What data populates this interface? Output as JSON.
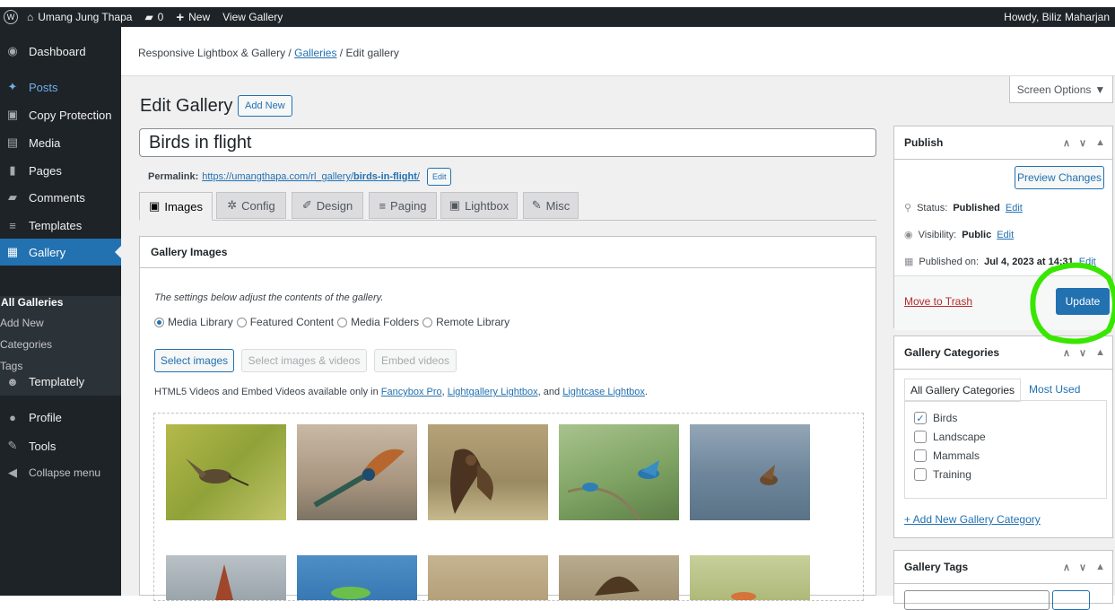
{
  "adminbar": {
    "site_name": "Umang Jung Thapa",
    "comments_count": "0",
    "new_label": "New",
    "view_gallery": "View Gallery",
    "howdy": "Howdy, Biliz Maharjan"
  },
  "sidebar": {
    "items": [
      {
        "label": "Dashboard",
        "icon": "dashboard-icon"
      },
      {
        "label": "Posts",
        "icon": "pin-icon"
      },
      {
        "label": "Copy Protection",
        "icon": "lock-icon"
      },
      {
        "label": "Media",
        "icon": "media-icon"
      },
      {
        "label": "Pages",
        "icon": "page-icon"
      },
      {
        "label": "Comments",
        "icon": "comment-icon"
      },
      {
        "label": "Templates",
        "icon": "templates-icon"
      },
      {
        "label": "Gallery",
        "icon": "gallery-icon"
      },
      {
        "label": "Templately",
        "icon": "templately-icon"
      },
      {
        "label": "Profile",
        "icon": "user-icon"
      },
      {
        "label": "Tools",
        "icon": "wrench-icon"
      },
      {
        "label": "Collapse menu",
        "icon": "collapse-icon"
      }
    ],
    "submenu": [
      "All Galleries",
      "Add New",
      "Categories",
      "Tags"
    ]
  },
  "breadcrumb": {
    "part1": "Responsive Lightbox & Gallery",
    "sep": " / ",
    "part2": "Galleries",
    "part3": "Edit gallery"
  },
  "screen_options": "Screen Options",
  "page": {
    "title": "Edit Gallery",
    "add_new": "Add New",
    "gallery_title": "Birds in flight",
    "permalink_label": "Permalink:",
    "permalink_base": "https://umangthapa.com/rl_gallery/",
    "permalink_slug": "birds-in-flight",
    "permalink_end": "/",
    "edit": "Edit"
  },
  "tabs": [
    "Images",
    "Config",
    "Design",
    "Paging",
    "Lightbox",
    "Misc"
  ],
  "gallery_images": {
    "heading": "Gallery Images",
    "description": "The settings below adjust the contents of the gallery.",
    "sources": [
      "Media Library",
      "Featured Content",
      "Media Folders",
      "Remote Library"
    ],
    "buttons": [
      "Select images",
      "Select images & videos",
      "Embed videos"
    ],
    "notice_prefix": "HTML5 Videos and Embed Videos available only in ",
    "notice_link1": "Fancybox Pro",
    "notice_sep1": ", ",
    "notice_link2": "Lightgallery Lightbox",
    "notice_sep2": ", and ",
    "notice_link3": "Lightcase Lightbox",
    "notice_end": "."
  },
  "publish": {
    "heading": "Publish",
    "preview": "Preview Changes",
    "status_label": "Status:",
    "status_value": "Published",
    "visibility_label": "Visibility:",
    "visibility_value": "Public",
    "published_label": "Published on:",
    "published_value": "Jul 4, 2023 at 14:31",
    "edit": "Edit",
    "trash": "Move to Trash",
    "update": "Update"
  },
  "categories": {
    "heading": "Gallery Categories",
    "tab_all": "All Gallery Categories",
    "tab_used": "Most Used",
    "items": [
      {
        "label": "Birds",
        "checked": true
      },
      {
        "label": "Landscape",
        "checked": false
      },
      {
        "label": "Mammals",
        "checked": false
      },
      {
        "label": "Training",
        "checked": false
      }
    ],
    "add": "+ Add New Gallery Category"
  },
  "tags": {
    "heading": "Gallery Tags"
  },
  "colors": {
    "accent": "#2271b1",
    "annotation": "#39e600",
    "sidebar": "#1d2327"
  }
}
